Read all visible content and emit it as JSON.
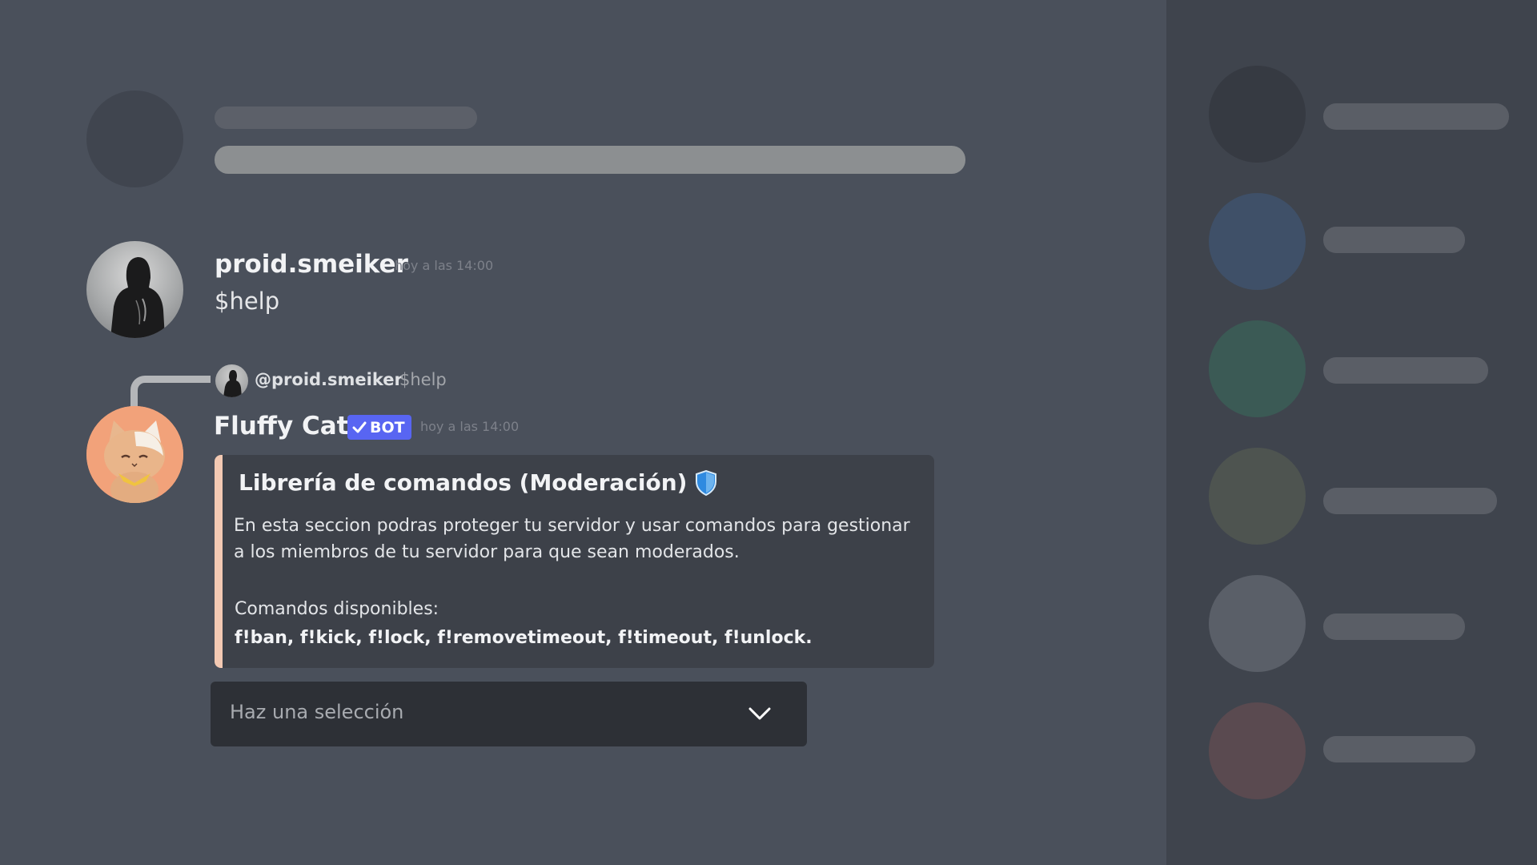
{
  "messages": [
    {
      "author": "proid.smeiker",
      "timestamp": "hoy a las 14:00",
      "content": "$help"
    },
    {
      "reply": {
        "mention": "@proid.smeiker",
        "text": "$help"
      },
      "author": "Fluffy Cat",
      "badge": "BOT",
      "timestamp": "hoy a las 14:00",
      "embed": {
        "title": "Librería de comandos (Moderación)",
        "title_icon": "shield-icon",
        "description": "En esta seccion podras proteger tu servidor y usar comandos para gestionar a los miembros de tu servidor para que sean moderados.",
        "commands_label": "Comandos disponibles:",
        "commands": "f!ban, f!kick, f!lock, f!removetimeout, f!timeout, f!unlock.",
        "accent_color": "#f3c9b3"
      },
      "select": {
        "placeholder": "Haz una selección",
        "icon": "chevron-down-icon"
      }
    }
  ],
  "colors": {
    "background": "#4a505b",
    "member_panel": "#3f444d",
    "badge": "#5865f2",
    "member_avatars": [
      "#363a42",
      "#3f5068",
      "#3b5a55",
      "#4e5450",
      "#5a5f68",
      "#5a4a50"
    ]
  }
}
